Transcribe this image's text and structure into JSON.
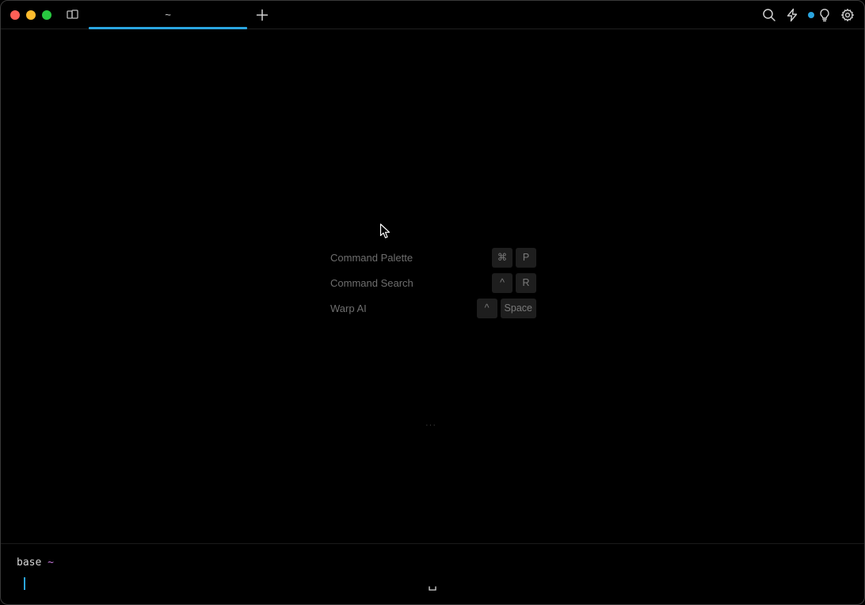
{
  "tabs": [
    {
      "title": "~",
      "active": true
    }
  ],
  "shortcuts": [
    {
      "label": "Command Palette",
      "keys": [
        "⌘",
        "P"
      ]
    },
    {
      "label": "Command Search",
      "keys": [
        "^",
        "R"
      ]
    },
    {
      "label": "Warp AI",
      "keys": [
        "^",
        "Space"
      ]
    }
  ],
  "ellipsis": "···",
  "prompt": {
    "env": "base",
    "dir": "~"
  },
  "colors": {
    "accent": "#2aa5e0",
    "prompt_dir": "#c678dd",
    "close": "#fe5f57",
    "minimize": "#febc2e",
    "maximize": "#28c840"
  },
  "icons": {
    "panel": "panel-toggle-icon",
    "new_tab": "plus-icon",
    "search": "search-icon",
    "bolt": "lightning-bolt-icon",
    "bulb": "lightbulb-icon",
    "settings": "gear-icon"
  }
}
